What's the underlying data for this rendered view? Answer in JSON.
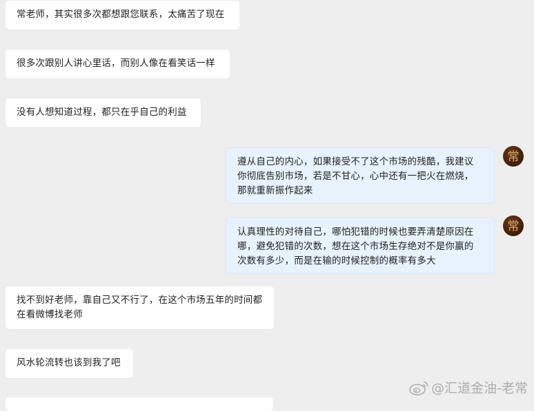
{
  "messages": [
    {
      "side": "in",
      "text": "常老师，其实很多次都想跟您联系，太痛苦了现在"
    },
    {
      "side": "in",
      "text": "很多次跟别人讲心里话，而别人像在看笑话一样"
    },
    {
      "side": "in",
      "text": "没有人想知道过程，都只在乎自己的利益"
    },
    {
      "side": "out",
      "text": "遵从自己的内心，如果接受不了这个市场的残酷，我建议你彻底告别市场，若是不甘心，心中还有一把火在燃烧，那就重新振作起来"
    },
    {
      "side": "out",
      "text": "认真理性的对待自己，哪怕犯错的时候也要弄清楚原因在哪，避免犯错的次数，想在这个市场生存绝对不是你赢的次数有多少，而是在输的时候控制的概率有多大"
    },
    {
      "side": "in",
      "text": "找不到好老师，靠自己又不行了，在这个市场五年的时间都在看微博找老师"
    },
    {
      "side": "in",
      "text": "风水轮流转也该到我了吧"
    }
  ],
  "avatar": {
    "glyph": "常",
    "color": "#3e1d09"
  },
  "watermark": {
    "icon": "weibo-icon",
    "text": "@汇道金油-老常"
  },
  "colors": {
    "incoming_bubble": "#ffffff",
    "outgoing_bubble": "#e7f2fd",
    "background": "#eeeeee"
  }
}
